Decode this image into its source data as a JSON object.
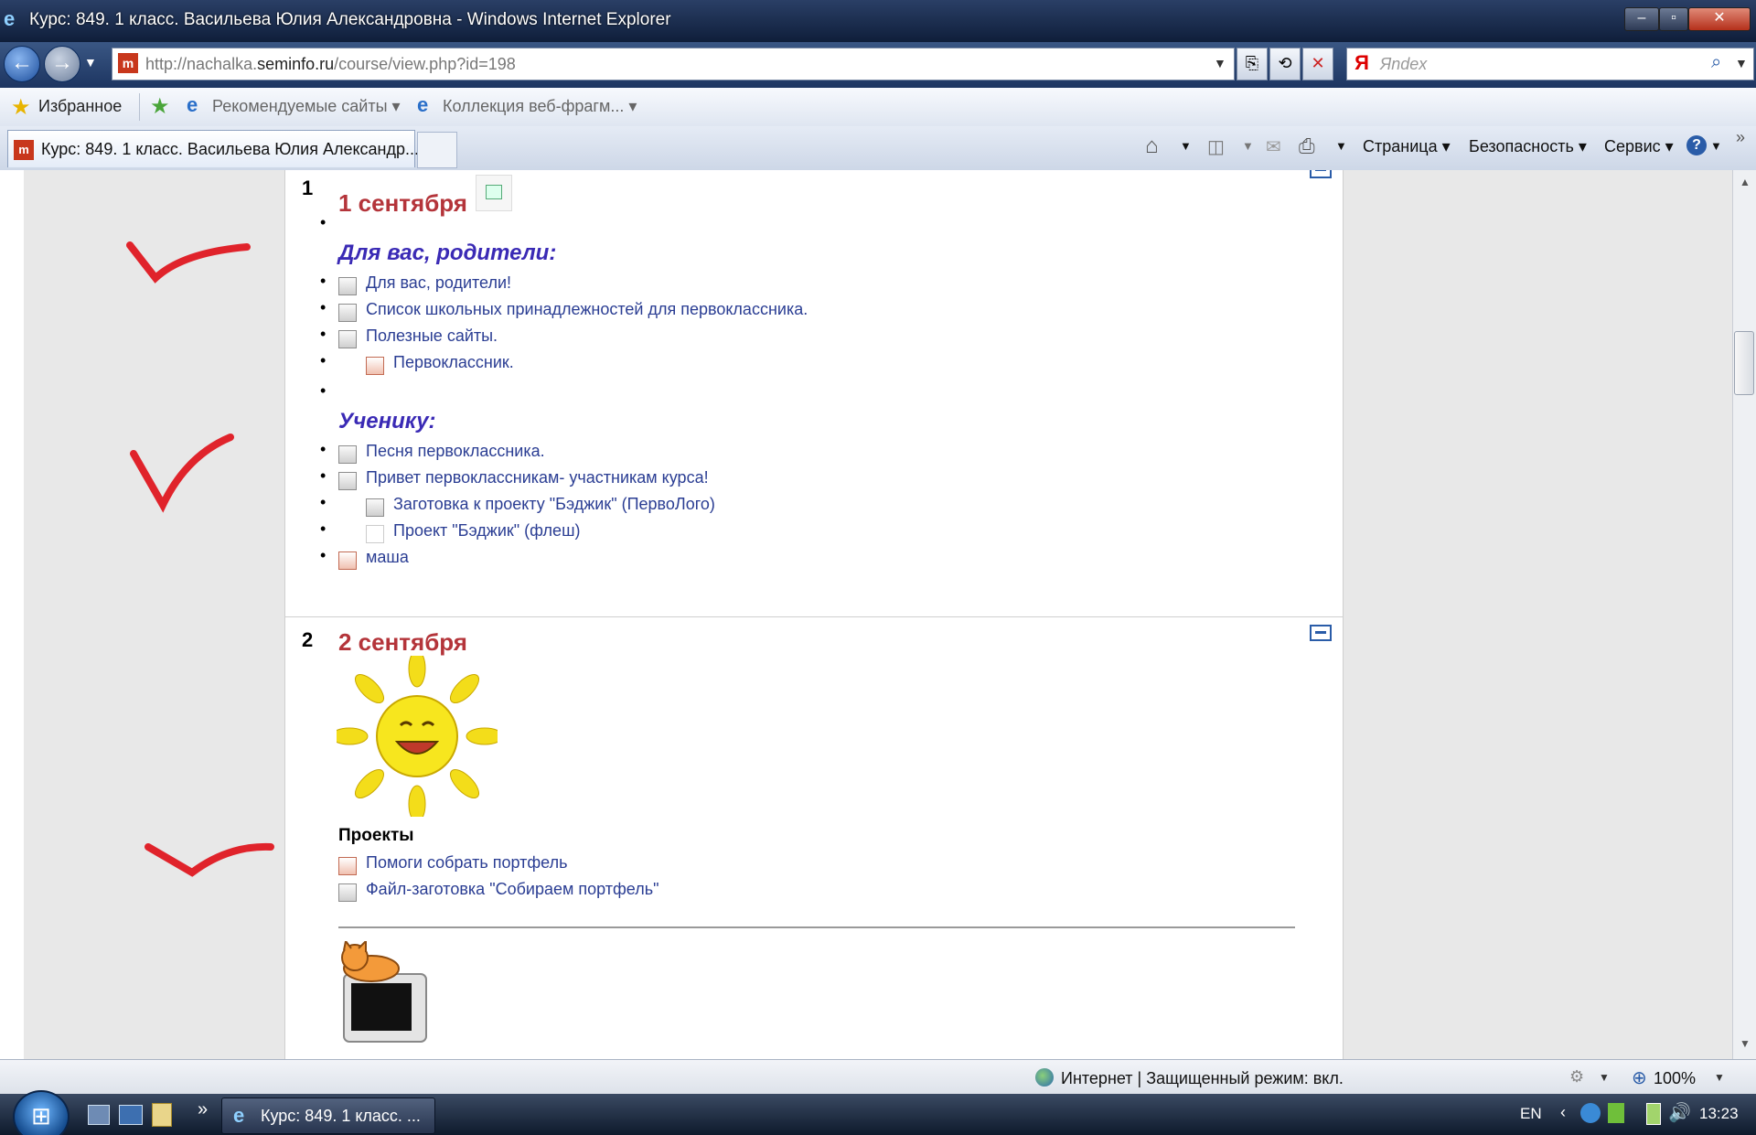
{
  "window": {
    "title": "Курс: 849. 1 класс. Васильева Юлия Александровна - Windows Internet Explorer"
  },
  "address": {
    "prefix": "http://nachalka.",
    "domain": "seminfo.ru",
    "path": "/course/view.php?id=198",
    "favicon": "m"
  },
  "search": {
    "placeholder": "Яndex",
    "logo": "Я"
  },
  "favorites": {
    "label": "Избранное",
    "items": [
      "Рекомендуемые сайты",
      "Коллекция веб-фрагм..."
    ]
  },
  "tab": {
    "title": "Курс: 849. 1 класс. Васильева Юлия Александр..."
  },
  "commands": {
    "page": "Страница",
    "security": "Безопасность",
    "tools": "Сервис"
  },
  "sections": [
    {
      "number": "1",
      "date": "1 сентября",
      "groups": [
        {
          "heading": "Для вас, родители:",
          "items": [
            {
              "text": "Для вас, родители!",
              "indent": false
            },
            {
              "text": "Список школьных принадлежностей для первоклассника.",
              "indent": false
            },
            {
              "text": "Полезные сайты.",
              "indent": false
            },
            {
              "text": "Первоклассник.",
              "indent": true
            }
          ]
        },
        {
          "heading": "Ученику:",
          "items": [
            {
              "text": "Песня первоклассника.",
              "indent": false
            },
            {
              "text": "Привет первоклассникам- участникам курса!",
              "indent": false
            },
            {
              "text": "Заготовка к проекту \"Бэджик\" (ПервоЛого)",
              "indent": true
            },
            {
              "text": "Проект \"Бэджик\" (флеш)",
              "indent": true
            },
            {
              "text": "маша",
              "indent": false
            }
          ]
        }
      ]
    },
    {
      "number": "2",
      "date": "2 сентября",
      "subheading": "Проекты",
      "items": [
        {
          "text": "Помоги собрать портфель"
        },
        {
          "text": "Файл-заготовка \"Собираем портфель\""
        }
      ]
    }
  ],
  "status": {
    "zone": "Интернет | Защищенный режим: вкл.",
    "zoom": "100%"
  },
  "taskbar": {
    "task": "Курс: 849. 1 класс. ...",
    "lang": "EN",
    "time": "13:23"
  },
  "colors": {
    "date": "#b4343a",
    "heading": "#3a2ab5",
    "link": "#2a3d93",
    "checkmark": "#e0232b"
  }
}
